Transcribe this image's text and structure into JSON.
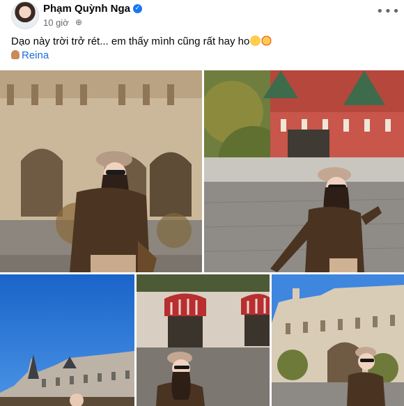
{
  "post": {
    "author_name": "Phạm Quỳnh Nga",
    "verified_icon": "verified-badge-icon",
    "timestamp": "10 giờ",
    "audience_icon": "globe-icon",
    "more_label": "•••",
    "caption": "Dạo này trời trở rét... em thấy mình cũng rất hay ho",
    "caption_emojis": [
      "winking-face",
      "smiling-face-with-hearts"
    ],
    "tag_icon": "person-tag-icon",
    "tagged_person": "Reina"
  },
  "colors": {
    "text": "#050505",
    "secondary_text": "#65676b",
    "link": "#216fdb",
    "verified": "#1877f2"
  },
  "photos": [
    {
      "subject": "woman in brown jacket and beret in front of arched building"
    },
    {
      "subject": "woman in beret on cobblestone square with red towers"
    },
    {
      "subject": "ornate building under clear blue sky"
    },
    {
      "subject": "woman in beret beside building with red awnings"
    },
    {
      "subject": "woman in beret on street in front of ornate building"
    }
  ]
}
